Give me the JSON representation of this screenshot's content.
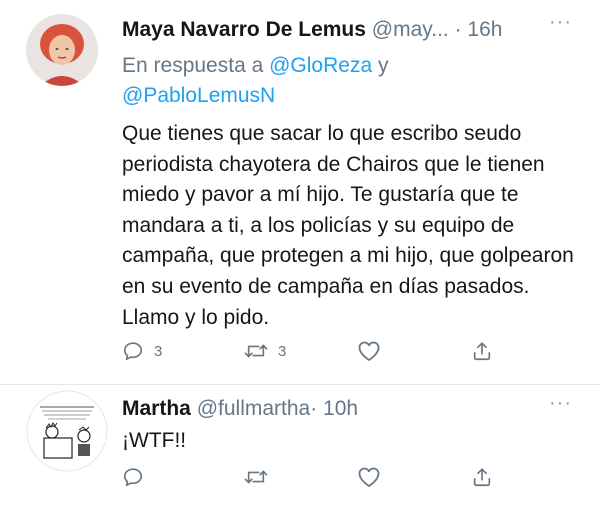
{
  "tweets": [
    {
      "author_name": "Maya Navarro De Lemus",
      "handle": "@may...",
      "time": "· 16h",
      "reply_prefix": "En respuesta a",
      "mention1": "@GloReza",
      "reply_and": "y",
      "mention2": "@PabloLemusN",
      "text": "Que tienes que sacar lo que escribo seudo periodista chayotera de Chairos que le tienen miedo y pavor a mí hijo. Te gustaría que te mandara a ti, a los policías y su equipo de campaña, que protegen a mi hijo, que golpearon en su evento de campaña en días pasados. Llamo y lo pido.",
      "reply_count": "3",
      "retweet_count": "3",
      "like_count": "",
      "more_label": "···"
    },
    {
      "author_name": "Martha",
      "handle": "@fullmartha",
      "time": "· 10h",
      "text": "¡WTF!!",
      "reply_count": "",
      "retweet_count": "",
      "like_count": "",
      "more_label": "···"
    }
  ],
  "colors": {
    "text": "#14171a",
    "secondary": "#657786",
    "link": "#1da1f2",
    "divider": "#e1e8ed"
  },
  "icons": [
    "reply-icon",
    "retweet-icon",
    "like-icon",
    "share-icon",
    "more-icon"
  ]
}
